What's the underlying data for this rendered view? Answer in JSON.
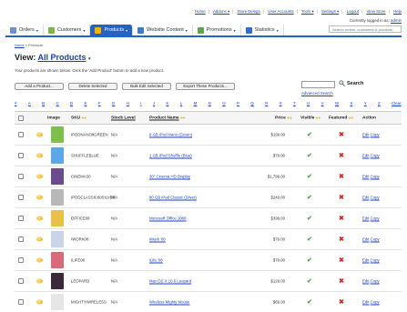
{
  "top_links": {
    "home": "Home",
    "addons": "Addons ▾",
    "store_design": "Store Design",
    "user_accounts": "User Accounts",
    "tools": "Tools ▾",
    "settings": "Settings ▾",
    "logout": "Logout",
    "view_store": "View Store",
    "help": "Help"
  },
  "logged_in": {
    "prefix": "Currently logged in as:",
    "user": "admin"
  },
  "top_search_placeholder": "Search orders, customers & products",
  "nav": {
    "items": [
      {
        "label": "Orders",
        "color": "#6c8fd9"
      },
      {
        "label": "Customers",
        "color": "#7ab648"
      },
      {
        "label": "Products",
        "color": "#f4b400"
      },
      {
        "label": "Website Content",
        "color": "#3a7bd5"
      },
      {
        "label": "Promotions",
        "color": "#5aa847"
      },
      {
        "label": "Statistics",
        "color": "#2f6fd0"
      }
    ],
    "active_index": 2
  },
  "breadcrumb": {
    "home": "Home",
    "sep": "»",
    "current": "Products"
  },
  "view": {
    "prefix": "View:",
    "selected": "All Products",
    "caret": "▾"
  },
  "subtitle": "Your products are shown below. Click the 'Add Product' button to add a new product.",
  "buttons": {
    "add": "Add a Product...",
    "delete": "Delete Selected",
    "bulk": "Bulk Edit Selected",
    "export": "Export These Products..."
  },
  "search": {
    "button": "Search",
    "advanced": "Advanced Search"
  },
  "letters": [
    "#",
    "A",
    "B",
    "C",
    "D",
    "E",
    "F",
    "G",
    "H",
    "I",
    "J",
    "K",
    "L",
    "M",
    "N",
    "O",
    "P",
    "Q",
    "R",
    "S",
    "T",
    "U",
    "V",
    "W",
    "X",
    "Y",
    "Z",
    "Clear"
  ],
  "table": {
    "headers": {
      "image": "Image",
      "sku": "SKU",
      "stock": "Stock Level",
      "name": "Product Name",
      "price": "Price",
      "visible": "Visible",
      "featured": "Featured",
      "action": "Action"
    },
    "rows": [
      {
        "sku": "IPODNANO8GREEN",
        "stock": "N/A",
        "name": "8 GB iPod Nano (Green)",
        "price": "$199.00",
        "visible": true,
        "featured": false,
        "thumb": "#7fc04d"
      },
      {
        "sku": "SHUFFLEBLUE",
        "stock": "N/A",
        "name": "1 GB iPod Shuffle (Blue)",
        "price": "$79.00",
        "visible": true,
        "featured": false,
        "thumb": "#5aa8e8"
      },
      {
        "sku": "CINEMA30",
        "stock": "N/A",
        "name": "30\" Cinema HD Display",
        "price": "$1,799.00",
        "visible": true,
        "featured": false,
        "thumb": "#6a4c8c"
      },
      {
        "sku": "IPODCLASSIC80SILVER",
        "stock": "N/A",
        "name": "80 GB iPod Classic (Silver)",
        "price": "$249.00",
        "visible": true,
        "featured": false,
        "thumb": "#b8b8b8"
      },
      {
        "sku": "OFFICE08",
        "stock": "N/A",
        "name": "Microsoft Office 2008",
        "price": "$399.00",
        "visible": true,
        "featured": false,
        "thumb": "#e8c04a"
      },
      {
        "sku": "IWORK08",
        "stock": "N/A",
        "name": "iWork '08",
        "price": "$79.00",
        "visible": true,
        "featured": false,
        "thumb": "#c8d4e8"
      },
      {
        "sku": "ILIFE08",
        "stock": "N/A",
        "name": "iLife '08",
        "price": "$79.00",
        "visible": true,
        "featured": false,
        "thumb": "#d86a7a"
      },
      {
        "sku": "LEOPARD",
        "stock": "N/A",
        "name": "Mac OS X 10.5 Leopard",
        "price": "$129.00",
        "visible": true,
        "featured": false,
        "thumb": "#3a2a3a"
      },
      {
        "sku": "MIGHTYWIRELESS",
        "stock": "N/A",
        "name": "Wireless Mighty Mouse",
        "price": "$69.00",
        "visible": true,
        "featured": false,
        "thumb": "#e6e6e6"
      }
    ],
    "edit_label": "Edit",
    "copy_label": "Copy",
    "visible_glyph": "✔",
    "featured_glyph": "✖",
    "sort_glyph": "◆◆"
  }
}
